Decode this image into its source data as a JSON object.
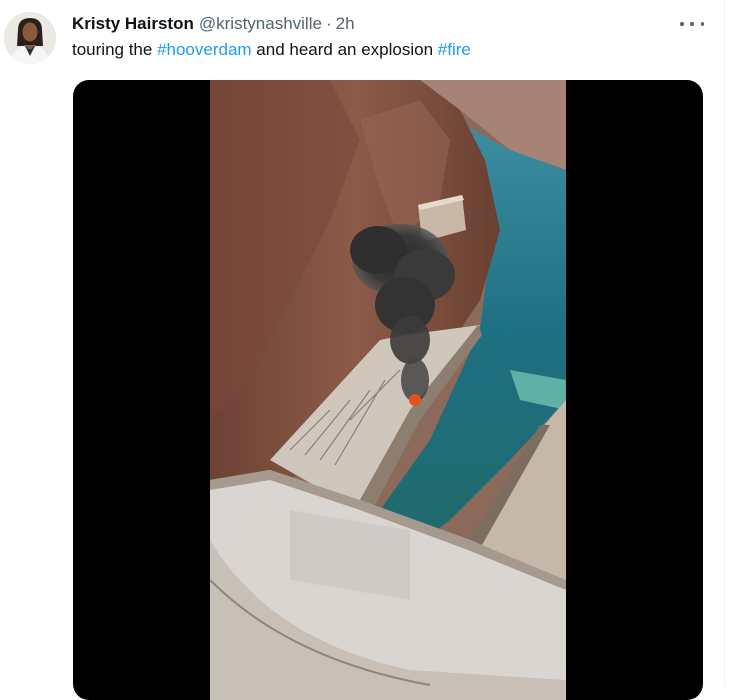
{
  "tweet": {
    "author_name": "Kristy Hairston",
    "handle": "@kristynashville",
    "separator": "·",
    "time": "2h",
    "text_part1": "touring the ",
    "hashtag1": "#hooverdam",
    "text_part2": " and heard an explosion ",
    "hashtag2": "#fire"
  },
  "icons": {
    "more": "more-horizontal-icon"
  },
  "colors": {
    "link": "#1d9bf0",
    "text": "#0f1419",
    "secondary": "#536471",
    "media_bg": "#000000"
  }
}
